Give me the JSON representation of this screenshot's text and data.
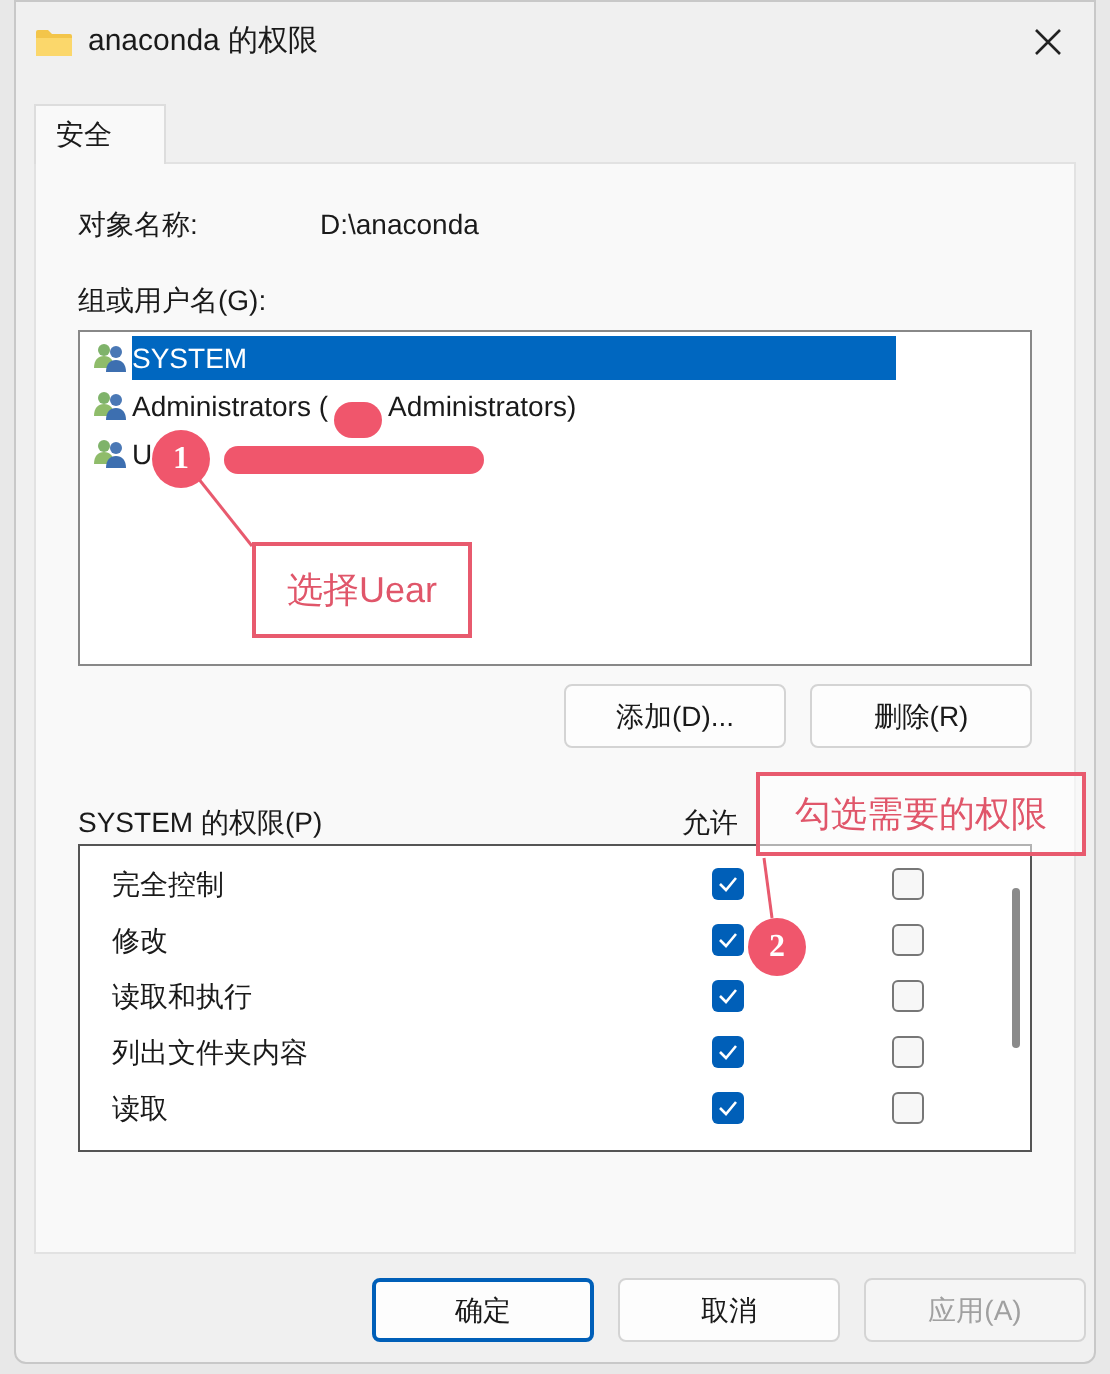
{
  "window": {
    "title": "anaconda 的权限"
  },
  "tabs": [
    {
      "label": "安全",
      "selected": true
    }
  ],
  "object_name": {
    "label": "对象名称:",
    "value": "D:\\anaconda"
  },
  "groups": {
    "label": "组或用户名(G):",
    "items": [
      {
        "name": "SYSTEM",
        "selected": true
      },
      {
        "name": "Administrators (",
        "suffix": "Administrators)",
        "selected": false
      },
      {
        "name": "U",
        "selected": false
      }
    ]
  },
  "group_buttons": [
    "添加(D)...",
    "删除(R)"
  ],
  "permissions": {
    "label": "SYSTEM 的权限(P)",
    "allow_header": "允许",
    "rows": [
      {
        "name": "完全控制",
        "allow": true,
        "deny": false
      },
      {
        "name": "修改",
        "allow": true,
        "deny": false
      },
      {
        "name": "读取和执行",
        "allow": true,
        "deny": false
      },
      {
        "name": "列出文件夹内容",
        "allow": true,
        "deny": false
      },
      {
        "name": "读取",
        "allow": true,
        "deny": false
      }
    ]
  },
  "buttons": [
    {
      "label": "确定",
      "default": true,
      "disabled": false
    },
    {
      "label": "取消",
      "default": false,
      "disabled": false
    },
    {
      "label": "应用(A)",
      "default": false,
      "disabled": true
    }
  ],
  "annotations": [
    {
      "number": "1",
      "note": "选择Uear"
    },
    {
      "number": "2",
      "note": "勾选需要的权限"
    }
  ]
}
